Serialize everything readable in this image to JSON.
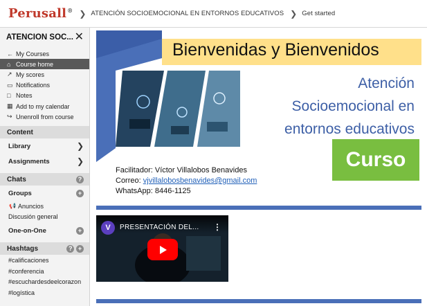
{
  "app": {
    "logo_text": "Perusall",
    "logo_mark": "®",
    "breadcrumb": [
      "ATENCIÓN SOCIOEMOCIONAL EN ENTORNOS EDUCATIVOS",
      "Get started"
    ]
  },
  "sidebar": {
    "course_title": "ATENCIÓN SOC...",
    "close_label": "✕",
    "nav": [
      {
        "label": "My Courses",
        "icon": "arrow-left-icon",
        "glyph": "←"
      },
      {
        "label": "Course home",
        "icon": "home-icon",
        "glyph": "⌂"
      },
      {
        "label": "My scores",
        "icon": "chart-icon",
        "glyph": "↗"
      },
      {
        "label": "Notifications",
        "icon": "notifications-icon",
        "glyph": "▭"
      },
      {
        "label": "Notes",
        "icon": "notes-icon",
        "glyph": "□"
      },
      {
        "label": "Add to my calendar",
        "icon": "calendar-icon",
        "glyph": "▦"
      },
      {
        "label": "Unenroll from course",
        "icon": "unenroll-icon",
        "glyph": "↪"
      }
    ],
    "content_head": "Content",
    "library_label": "Library",
    "assignments_label": "Assignments",
    "chats_head": "Chats",
    "chats_btn": "?",
    "groups_label": "Groups",
    "groups_btn": "+",
    "groups_items": [
      "Anuncios",
      "Discusión general"
    ],
    "one_on_one_label": "One-on-One",
    "one_on_one_btn": "+",
    "hashtags_head": "Hashtags",
    "hashtags_help": "?",
    "hashtags_add": "+",
    "hashtags": [
      "#calificaciones",
      "#conferencia",
      "#escuchardesdeelcorazon",
      "#logística"
    ]
  },
  "slide": {
    "title": "Bienvenidas y Bienvenidos",
    "subtitle_lines": [
      "Atención",
      "Socioemocional en",
      "entornos educativos"
    ],
    "badge": "Curso",
    "facilitator": "Facilitador: Víctor Villalobos Benavides",
    "email_label": "Correo: ",
    "email": "vjvillalobosbenavides@gmail.com",
    "whatsapp": "WhatsApp: 8446-1125"
  },
  "video": {
    "channel_initial": "V",
    "title": "PRESENTACIÓN DEL...",
    "menu": "⋮"
  },
  "colors": {
    "accent_red": "#c0392b",
    "active_nav": "#595959",
    "slide_blue": "#4a6fb8",
    "slide_yellow": "#ffe08a",
    "badge_green": "#79be40",
    "subtitle_blue": "#3d5fa6",
    "youtube_red": "#ff0000"
  }
}
